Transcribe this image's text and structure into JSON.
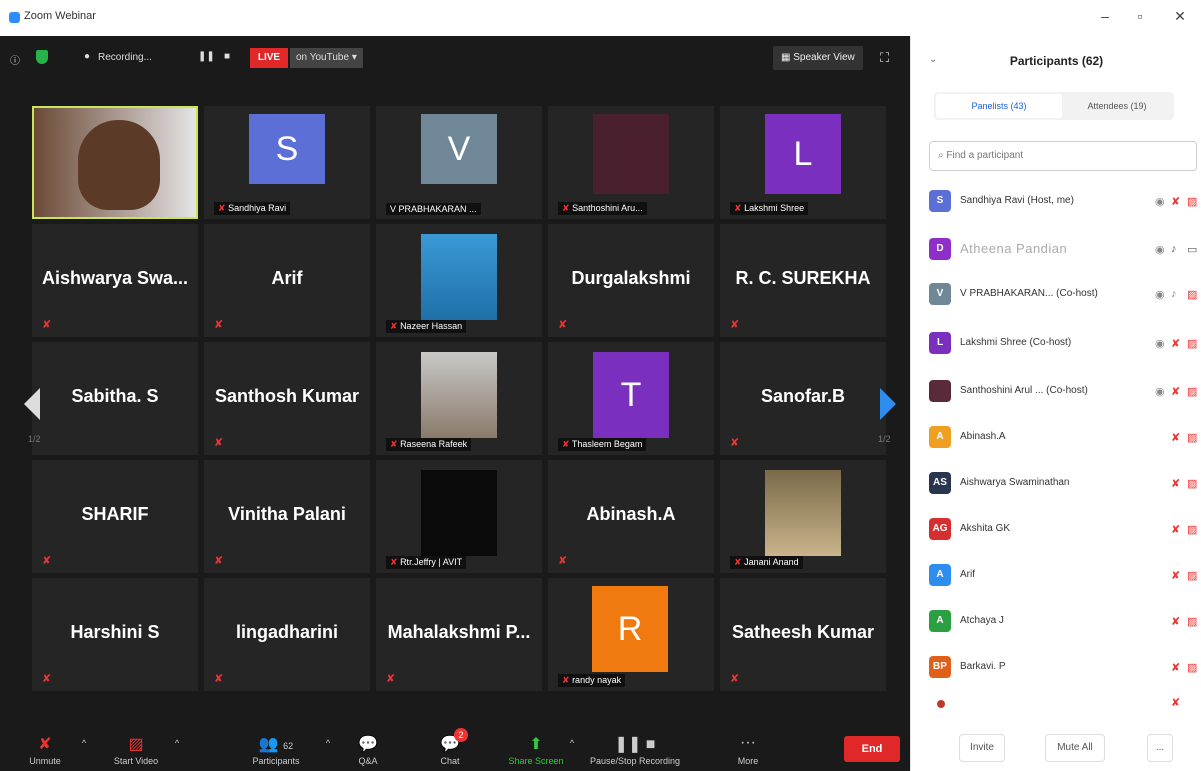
{
  "window": {
    "title": "Zoom Webinar"
  },
  "topbar": {
    "recording_label": "Recording...",
    "live_label": "LIVE",
    "youtube_label": "on YouTube",
    "speaker_view_label": "Speaker View"
  },
  "pagination": {
    "left": "1/2",
    "right": "1/2"
  },
  "tiles": [
    {
      "label": ""
    },
    {
      "label": "Sandhiya Ravi",
      "letter": "S"
    },
    {
      "label": "V PRABHAKARAN ...",
      "letter": "V"
    },
    {
      "label": "Santhoshini Aru..."
    },
    {
      "label": "Lakshmi Shree",
      "letter": "L"
    },
    {
      "label": "Aishwarya Swa..."
    },
    {
      "label": "Arif"
    },
    {
      "label": "Nazeer Hassan"
    },
    {
      "label": "Durgalakshmi"
    },
    {
      "label": "R. C. SUREKHA"
    },
    {
      "label": "Sabitha. S"
    },
    {
      "label": "Santhosh Kumar"
    },
    {
      "label": "Raseena Rafeek"
    },
    {
      "label": "Thasleem Begam",
      "letter": "T"
    },
    {
      "label": "Sanofar.B"
    },
    {
      "label": "SHARIF"
    },
    {
      "label": "Vinitha Palani"
    },
    {
      "label": "Rtr.Jeffry | AVIT"
    },
    {
      "label": "Abinash.A"
    },
    {
      "label": "Janani Anand"
    },
    {
      "label": "Harshini S"
    },
    {
      "label": "lingadharini"
    },
    {
      "label": "Mahalakshmi P..."
    },
    {
      "label": "randy nayak",
      "letter": "R"
    },
    {
      "label": "Satheesh Kumar"
    }
  ],
  "controls": {
    "unmute": "Unmute",
    "start_video": "Start Video",
    "participants": "Participants",
    "participants_count": "62",
    "qa": "Q&A",
    "chat": "Chat",
    "chat_badge": "2",
    "share_screen": "Share Screen",
    "pause_recording": "Pause/Stop Recording",
    "more": "More",
    "end": "End"
  },
  "panel": {
    "title": "Participants (62)",
    "tab_panelists": "Panelists (43)",
    "tab_attendees": "Attendees (19)",
    "search_placeholder": "Find a participant",
    "participants": [
      {
        "initials": "S",
        "name": "Sandhiya Ravi (Host, me)",
        "color": "#5b6fd6"
      },
      {
        "initials": "D",
        "name": "Atheena Pandian",
        "color": "#8e2fc9"
      },
      {
        "initials": "V",
        "name": "V PRABHAKARAN... (Co-host)",
        "color": "#6f8797"
      },
      {
        "initials": "L",
        "name": "Lakshmi Shree (Co-host)",
        "color": "#7a2fbf"
      },
      {
        "initials": "",
        "name": "Santhoshini Arul ... (Co-host)",
        "color": "#5a2a3a"
      },
      {
        "initials": "A",
        "name": "Abinash.A",
        "color": "#f0a020"
      },
      {
        "initials": "AS",
        "name": "Aishwarya Swaminathan",
        "color": "#2a3650"
      },
      {
        "initials": "AG",
        "name": "Akshita GK",
        "color": "#d62f2f"
      },
      {
        "initials": "A",
        "name": "Arif",
        "color": "#2e8ef0"
      },
      {
        "initials": "A",
        "name": "Atchaya J",
        "color": "#2aa040"
      },
      {
        "initials": "BP",
        "name": "Barkavi. P",
        "color": "#e0601a"
      }
    ],
    "invite": "Invite",
    "mute_all": "Mute All",
    "more": "..."
  }
}
